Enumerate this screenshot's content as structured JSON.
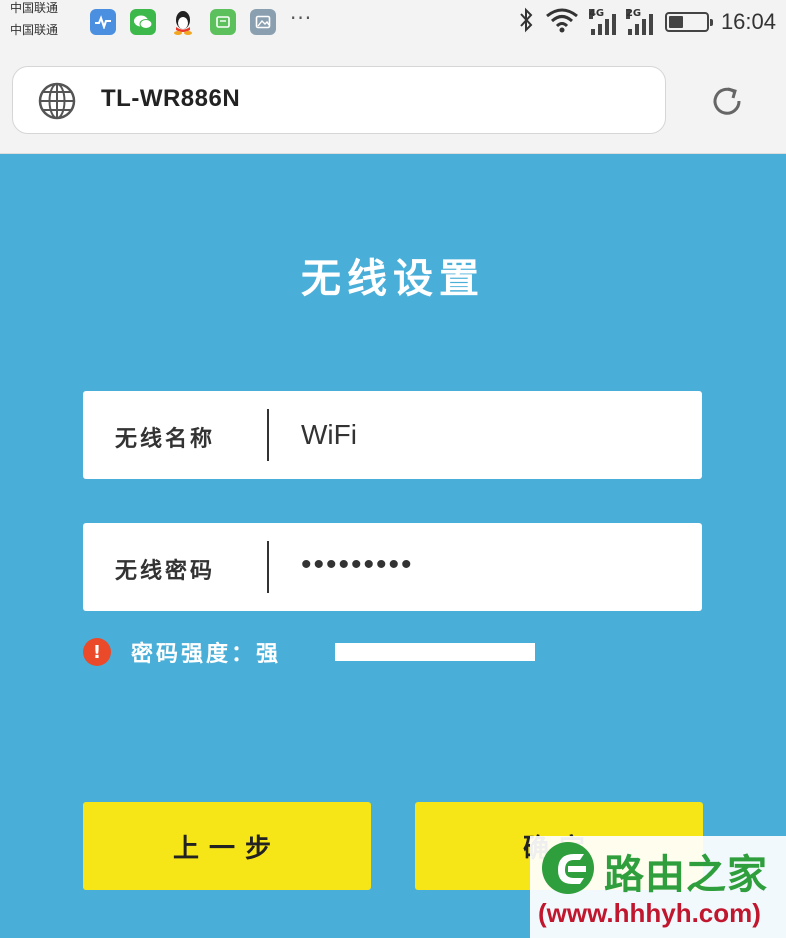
{
  "status_bar": {
    "carrier_1": "中国联通",
    "carrier_2": "中国联通",
    "notification_icons": [
      "health-app-icon",
      "wechat-icon",
      "qq-icon",
      "sms-app-icon",
      "gallery-app-icon"
    ],
    "more_indicator": "···",
    "signal_1_label": "4G",
    "signal_2_label": "2G",
    "battery_level": 0.4,
    "time": "16:04"
  },
  "address_bar": {
    "url": "TL-WR886N"
  },
  "page": {
    "title": "无线设置",
    "wifi_name": {
      "label": "无线名称",
      "value": "WiFi"
    },
    "wifi_password": {
      "label": "无线密码",
      "value": "•••••••••"
    },
    "password_strength": {
      "label": "密码强度：强"
    },
    "buttons": {
      "prev": "上一步",
      "confirm": "确定"
    }
  },
  "watermark": {
    "name": "路由之家",
    "url": "(www.hhhyh.com)"
  },
  "colors": {
    "background": "#4aafd8",
    "button": "#f7e617",
    "warning": "#ea4a2a",
    "watermark_green": "#2f9e3c",
    "watermark_red": "#c0172e"
  }
}
